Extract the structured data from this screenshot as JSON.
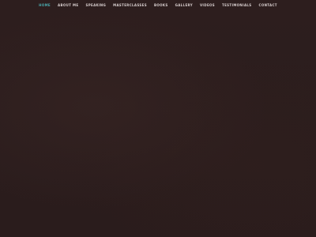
{
  "nav": {
    "items": [
      {
        "label": "HOME",
        "active": true
      },
      {
        "label": "ABOUT ME",
        "active": false
      },
      {
        "label": "SPEAKING",
        "active": false
      },
      {
        "label": "MASTERCLASSES",
        "active": false
      },
      {
        "label": "BOOKS",
        "active": false
      },
      {
        "label": "GALLERY",
        "active": false
      },
      {
        "label": "VIDEOS",
        "active": false
      },
      {
        "label": "TESTIMONIALS",
        "active": false
      },
      {
        "label": "CONTACT",
        "active": false
      }
    ]
  },
  "colors": {
    "background": "#2c1d1d",
    "nav_text": "#d8cfcf",
    "nav_active": "#4aa9ad"
  }
}
